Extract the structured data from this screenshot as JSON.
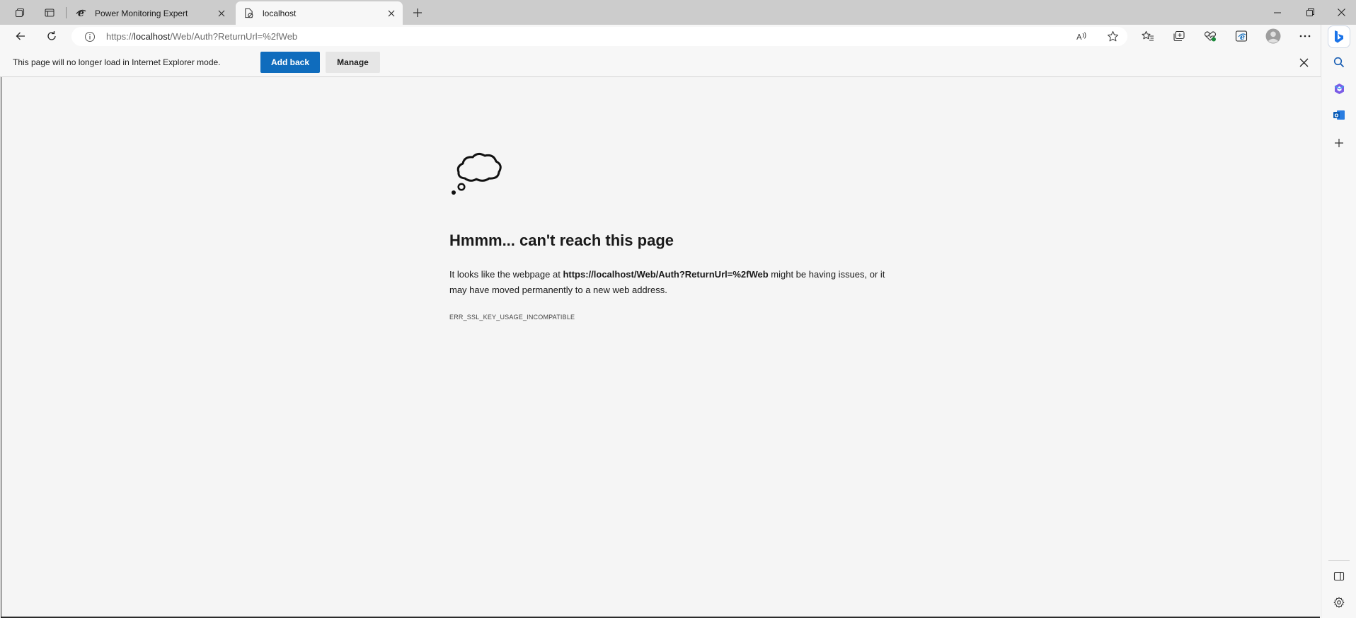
{
  "tabs": [
    {
      "title": "Power Monitoring Expert",
      "icon": "ie-icon",
      "active": false
    },
    {
      "title": "localhost",
      "icon": "page-error-icon",
      "active": true
    }
  ],
  "address": {
    "url_prefix": "https://",
    "url_host": "localhost",
    "url_path": "/Web/Auth?ReturnUrl=%2fWeb"
  },
  "infobar": {
    "message": "This page will no longer load in Internet Explorer mode.",
    "add_back_label": "Add back",
    "manage_label": "Manage"
  },
  "error": {
    "title": "Hmmm... can't reach this page",
    "body_before": "It looks like the webpage at ",
    "body_url": "https://localhost/Web/Auth?ReturnUrl=%2fWeb",
    "body_after": " might be having issues, or it may have moved permanently to a new web address.",
    "code": "ERR_SSL_KEY_USAGE_INCOMPATIBLE"
  },
  "colors": {
    "accent": "#0f6cbd",
    "page_bg": "#f5f5f5",
    "chrome_bg": "#f7f7f7",
    "tabstrip_bg": "#cccccc"
  },
  "icons": {
    "toolbar": [
      "back-icon",
      "refresh-icon",
      "read-aloud-icon",
      "favorite-star-icon",
      "favorites-icon",
      "collections-icon",
      "browser-essentials-icon",
      "ie-mode-icon",
      "profile-avatar-icon",
      "more-icon"
    ],
    "sidebar": [
      "bing-icon",
      "search-icon",
      "office-icon",
      "outlook-icon",
      "add-icon",
      "hide-sidebar-icon",
      "settings-icon"
    ]
  }
}
